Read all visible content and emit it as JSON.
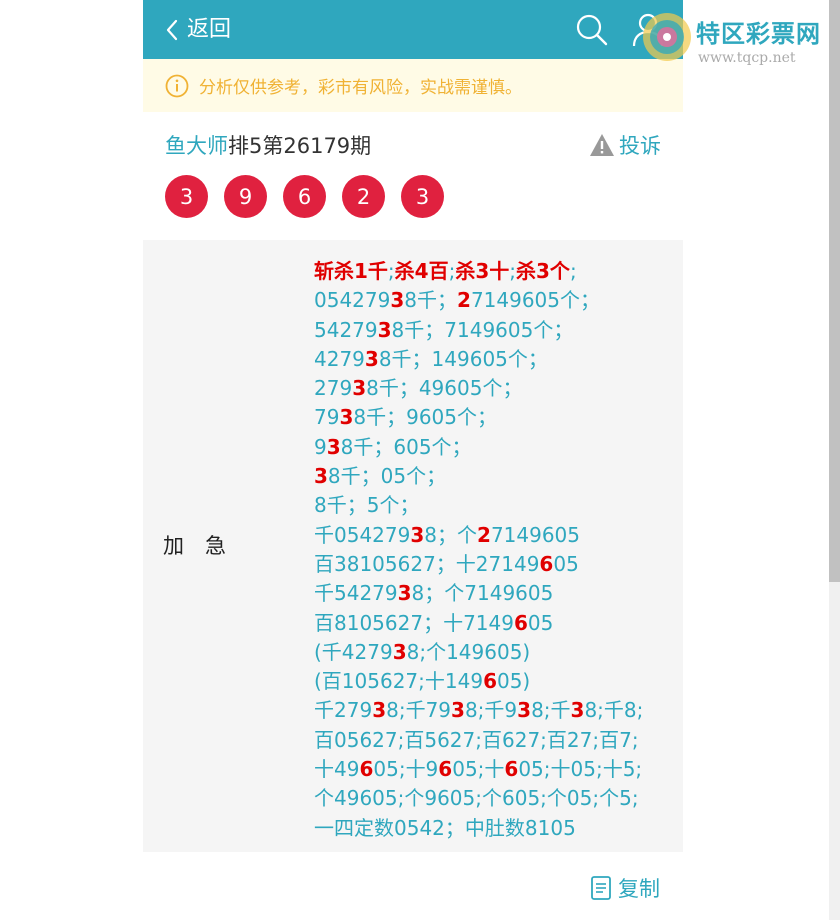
{
  "header": {
    "back_label": "返回"
  },
  "notice": {
    "text": "分析仅供参考，彩市有风险，实战需谨慎。"
  },
  "title": {
    "author": "鱼大师",
    "issue": "排5第26179期",
    "report_label": "投诉"
  },
  "balls": [
    "3",
    "9",
    "6",
    "2",
    "3"
  ],
  "content": {
    "label": "加　急",
    "kill_line": [
      "斩杀1千",
      ";",
      "杀4百",
      ";",
      "杀3十",
      ";",
      "杀3个",
      ";"
    ],
    "lines": [
      [
        [
          "054279",
          ""
        ],
        [
          "3",
          "h"
        ],
        [
          "8千；",
          ""
        ],
        [
          "2",
          "h"
        ],
        [
          "7149605个；",
          ""
        ]
      ],
      [
        [
          "54279",
          ""
        ],
        [
          "3",
          "h"
        ],
        [
          "8千；7149605个；",
          ""
        ]
      ],
      [
        [
          "4279",
          ""
        ],
        [
          "3",
          "h"
        ],
        [
          "8千；149605个；",
          ""
        ]
      ],
      [
        [
          "279",
          ""
        ],
        [
          "3",
          "h"
        ],
        [
          "8千；49605个；",
          ""
        ]
      ],
      [
        [
          "79",
          ""
        ],
        [
          "3",
          "h"
        ],
        [
          "8千；9605个；",
          ""
        ]
      ],
      [
        [
          "9",
          ""
        ],
        [
          "3",
          "h"
        ],
        [
          "8千；605个；",
          ""
        ]
      ],
      [
        [
          "3",
          "h"
        ],
        [
          "8千；05个；",
          ""
        ]
      ],
      [
        [
          "8千；5个；",
          ""
        ]
      ],
      [
        [
          "千054279",
          ""
        ],
        [
          "3",
          "h"
        ],
        [
          "8；个",
          ""
        ],
        [
          "2",
          "h"
        ],
        [
          "7149605",
          ""
        ]
      ],
      [
        [
          "百38105627；十27149",
          ""
        ],
        [
          "6",
          "h"
        ],
        [
          "05",
          ""
        ]
      ],
      [
        [
          "千54279",
          ""
        ],
        [
          "3",
          "h"
        ],
        [
          "8；个7149605",
          ""
        ]
      ],
      [
        [
          "百8105627；十7149",
          ""
        ],
        [
          "6",
          "h"
        ],
        [
          "05",
          ""
        ]
      ],
      [
        [
          "(千4279",
          ""
        ],
        [
          "3",
          "h"
        ],
        [
          "8;个149605)",
          ""
        ]
      ],
      [
        [
          "(百105627;十149",
          ""
        ],
        [
          "6",
          "h"
        ],
        [
          "05)",
          ""
        ]
      ],
      [
        [
          "千279",
          ""
        ],
        [
          "3",
          "h"
        ],
        [
          "8;千79",
          ""
        ],
        [
          "3",
          "h"
        ],
        [
          "8;千9",
          ""
        ],
        [
          "3",
          "h"
        ],
        [
          "8;千",
          ""
        ],
        [
          "3",
          "h"
        ],
        [
          "8;千8;",
          ""
        ]
      ],
      [
        [
          "百05627;百5627;百627;百27;百7;",
          ""
        ]
      ],
      [
        [
          "十49",
          ""
        ],
        [
          "6",
          "h"
        ],
        [
          "05;十9",
          ""
        ],
        [
          "6",
          "h"
        ],
        [
          "05;十",
          ""
        ],
        [
          "6",
          "h"
        ],
        [
          "05;十05;十5;",
          ""
        ]
      ],
      [
        [
          "个49605;个9605;个605;个05;个5;",
          ""
        ]
      ],
      [
        [
          "一四定数0542；中肚数8105",
          ""
        ]
      ]
    ]
  },
  "copy_label": "复制",
  "watermark": {
    "brand": "特区彩票网",
    "url": "www.tqcp.net"
  },
  "colors": {
    "primary": "#2fa7be",
    "ball": "#e0213f",
    "highlight": "#e00000",
    "notice_bg": "#fffbe6",
    "notice_text": "#f0b234"
  }
}
